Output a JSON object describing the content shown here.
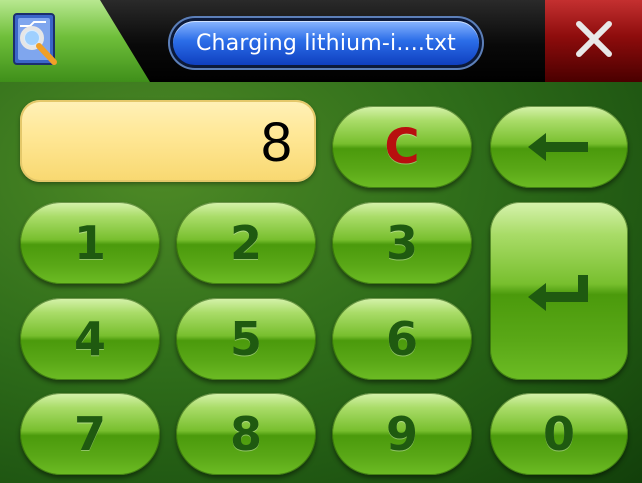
{
  "titlebar": {
    "filename": "Charging lithium-i....txt",
    "app_icon": "magnifier-document-icon",
    "close_icon": "close-icon"
  },
  "colors": {
    "background": "#2f6d1a",
    "key_green": "#6cbc24",
    "display_yellow": "#ffe898",
    "clear_red": "#b80f0f",
    "filename_blue": "#2b6de8",
    "close_red": "#8d0c0c"
  },
  "display": {
    "value": "8"
  },
  "keypad": {
    "clear_label": "C",
    "backspace_icon": "arrow-left-icon",
    "enter_icon": "return-arrow-icon",
    "digits": [
      "1",
      "2",
      "3",
      "4",
      "5",
      "6",
      "7",
      "8",
      "9",
      "0"
    ]
  }
}
